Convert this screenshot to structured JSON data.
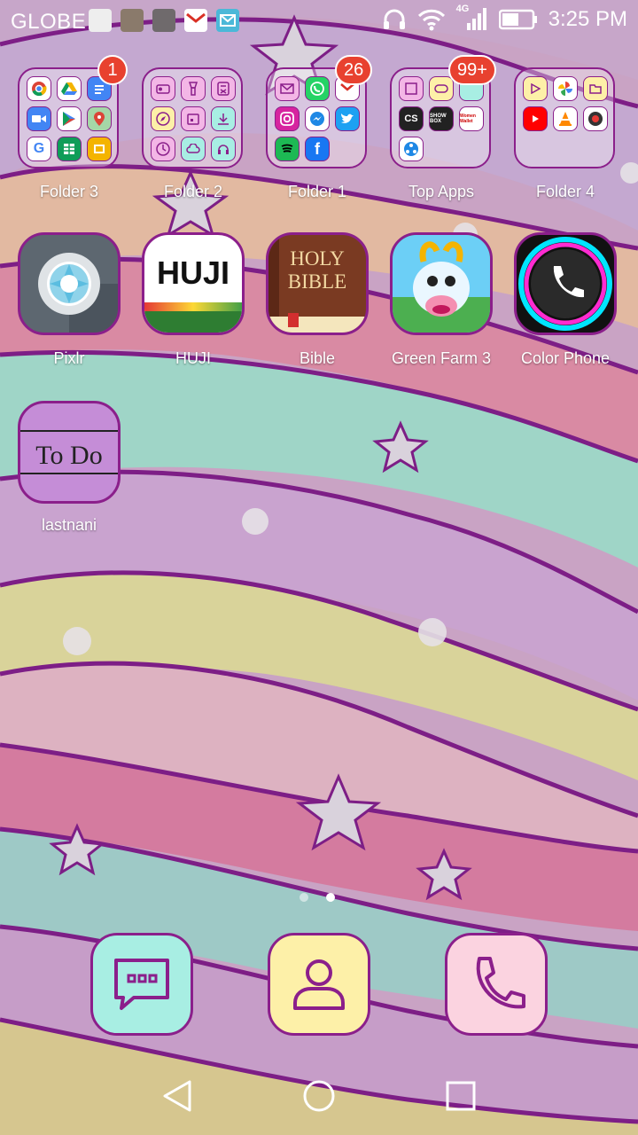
{
  "status_bar": {
    "carrier": "GLOBE",
    "network": "4G",
    "time": "3:25 PM"
  },
  "folders": [
    {
      "label": "Folder 3",
      "badge": "1"
    },
    {
      "label": "Folder 2",
      "badge": ""
    },
    {
      "label": "Folder 1",
      "badge": "26"
    },
    {
      "label": "Top Apps",
      "badge": "99+"
    },
    {
      "label": "Folder 4",
      "badge": ""
    }
  ],
  "apps": [
    {
      "label": "Pixlr"
    },
    {
      "label": "HUJI",
      "icon_text": "HUJI"
    },
    {
      "label": "Bible",
      "icon_text_1": "HOLY",
      "icon_text_2": "BIBLE"
    },
    {
      "label": "Green Farm 3"
    },
    {
      "label": "Color Phone"
    },
    {
      "label": "lastnani",
      "icon_text": "To Do"
    }
  ],
  "top_apps_icons": {
    "cs": "CS",
    "showbox": "SHOW BOX",
    "women": "Women Wallet"
  },
  "dock": [
    "messages-icon",
    "contacts-icon",
    "phone-icon"
  ],
  "page_indicator": {
    "pages": 2,
    "current": 2
  },
  "colors": {
    "accent": "#8b1f8b",
    "badge": "#e8412f",
    "messages_bg": "#a8eee3",
    "contacts_bg": "#fdf0a8",
    "phone_bg": "#fbd3e0"
  }
}
